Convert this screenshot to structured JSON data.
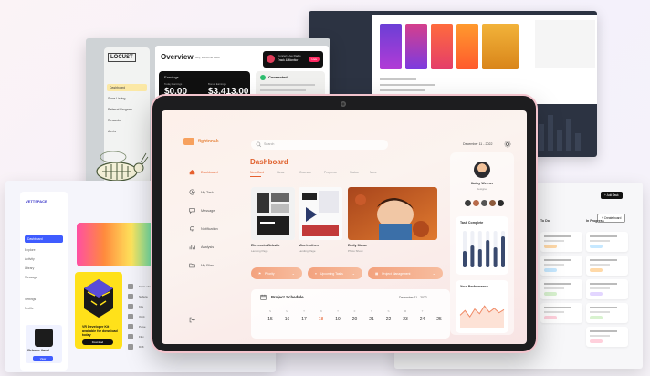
{
  "colors": {
    "accent": "#e6602e",
    "accent_soft": "#f3a27e",
    "tablet_bezel": "#1d1d1f",
    "tablet_rim": "#f3c4cd",
    "locust_highlight": "#fbe8a6",
    "vettspace_primary": "#3f5cff",
    "vettspace_yellow": "#ffe11a"
  },
  "tablet": {
    "brand": "fightnnak",
    "search_placeholder": "Search",
    "date": "December 11 - 2022",
    "title": "Dashboard",
    "tabs": [
      "New Card",
      "Ideas",
      "Courses",
      "Progress",
      "Status",
      "More"
    ],
    "active_tab": 0,
    "sidebar": [
      {
        "label": "Dashboard",
        "icon": "home-icon",
        "active": true
      },
      {
        "label": "My Task",
        "icon": "clock-icon",
        "active": false
      },
      {
        "label": "Message",
        "icon": "chat-icon",
        "active": false
      },
      {
        "label": "Notification",
        "icon": "bell-icon",
        "active": false
      },
      {
        "label": "Analysis",
        "icon": "chart-icon",
        "active": false
      },
      {
        "label": "My Files",
        "icon": "folder-icon",
        "active": false
      }
    ],
    "projects": [
      {
        "title": "Elevecoin Website",
        "subtitle": "Landing Page"
      },
      {
        "title": "Mira Lorthen",
        "subtitle": "Landing Page"
      },
      {
        "title": "Emily Meroe",
        "subtitle": "Photo Shoot"
      }
    ],
    "pills": [
      "Priority",
      "Upcoming Tasks",
      "Project Management"
    ],
    "schedule": {
      "title": "Project Schedule",
      "date": "December 11 - 2022",
      "days": [
        "S",
        "M",
        "T",
        "W",
        "T",
        "F",
        "S",
        "S",
        "M",
        "T"
      ],
      "numbers": [
        "15",
        "16",
        "17",
        "18",
        "19",
        "20",
        "21",
        "22",
        "23",
        "24",
        "25"
      ],
      "highlight_index": 3
    },
    "profile": {
      "name": "Kathy Werner",
      "role": "Designer",
      "task_title": "Task Complete",
      "task_bars": [
        0.45,
        0.6,
        0.5,
        0.75,
        0.55,
        0.85
      ],
      "perf_title": "Your Performance",
      "perf_values": [
        0.4,
        0.55,
        0.35,
        0.6,
        0.45,
        0.7,
        0.5,
        0.62,
        0.48,
        0.58
      ]
    }
  },
  "locust": {
    "brand": "LOCUST",
    "title": "Overview",
    "subtitle": "Hey, Welcome Back",
    "nav": [
      "Dashboard",
      "Store Listing",
      "Referral Program",
      "Rewards",
      "Alerts"
    ],
    "earnings_label": "Earnings",
    "earnings_today_label": "Today Earnings",
    "earnings_today": "$0.00",
    "earnings_total_label": "Bonus Earnings",
    "earnings_total": "$3,413.00",
    "connected_label": "Connected",
    "live_label": "Live",
    "stream_caption": "Concert Live Radio",
    "live_title": "Track & Monitor"
  },
  "vettspace": {
    "brand": "VETTSPACE",
    "nav": [
      "Dashboard",
      "Explore",
      "Activity",
      "Library",
      "Message",
      "Settings",
      "Profile"
    ],
    "active_nav": 0,
    "welcome": "Welcome Jamal",
    "welcome_button": "View",
    "promo_text": "VR Developer Kit available for download today",
    "promo_button": "Download",
    "table_rows": [
      "Sigil Labs",
      "Nebula",
      "Kite",
      "Orbit",
      "Pulse",
      "Flux",
      "Drift"
    ]
  },
  "board": {
    "button_primary": "+ Add Task",
    "button_secondary": "+ Create board",
    "columns": [
      "To Do",
      "In Progress",
      "Review",
      "Done"
    ]
  },
  "dark_shot": {
    "caption": "Gradient Collection"
  }
}
